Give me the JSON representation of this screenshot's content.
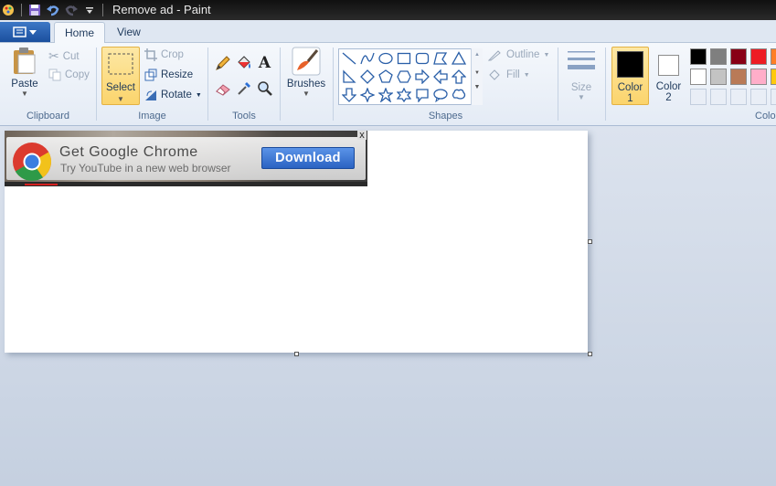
{
  "window": {
    "title": "Remove ad - Paint"
  },
  "tabs": {
    "home": "Home",
    "view": "View"
  },
  "clipboard": {
    "paste": "Paste",
    "cut": "Cut",
    "copy": "Copy",
    "label": "Clipboard"
  },
  "image": {
    "select": "Select",
    "crop": "Crop",
    "resize": "Resize",
    "rotate": "Rotate",
    "label": "Image"
  },
  "tools": {
    "label": "Tools"
  },
  "brushes": {
    "label": "Brushes"
  },
  "shapes": {
    "outline": "Outline",
    "fill": "Fill",
    "label": "Shapes"
  },
  "size": {
    "label": "Size"
  },
  "colors": {
    "color1_line1": "Color",
    "color1_line2": "1",
    "color2_line1": "Color",
    "color2_line2": "2",
    "label": "Colo",
    "color1": "#000000",
    "color2": "#ffffff",
    "palette_row1": [
      "#000000",
      "#7f7f7f",
      "#880015",
      "#ed1c24",
      "#ff7f27"
    ],
    "palette_row2": [
      "#ffffff",
      "#c3c3c3",
      "#b97a57",
      "#ffaec9",
      "#ffc90e"
    ]
  },
  "ad": {
    "title": "Get Google Chrome",
    "subtitle": "Try YouTube in a new web browser",
    "download": "Download",
    "close": "x"
  }
}
